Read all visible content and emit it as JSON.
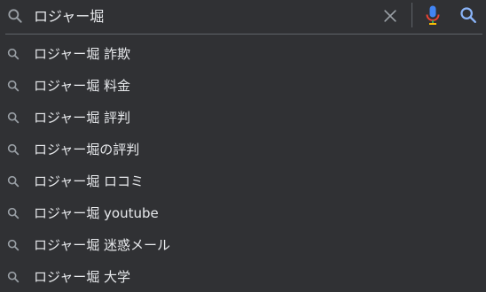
{
  "search": {
    "query": "ロジャー堀",
    "icons": {
      "leading": "search-icon",
      "clear": "close-icon",
      "voice": "microphone-icon",
      "submit": "search-icon"
    },
    "colors": {
      "background": "#303134",
      "text": "#e8eaed",
      "icon": "#9aa0a6",
      "submit": "#8ab4f8",
      "mic_blue": "#4285f4",
      "mic_red": "#ea4335",
      "mic_yellow": "#fbbc05",
      "mic_green": "#34a853"
    }
  },
  "suggestions": [
    {
      "text": "ロジャー堀 詐欺",
      "icon": "search-icon"
    },
    {
      "text": "ロジャー堀 料金",
      "icon": "search-icon"
    },
    {
      "text": "ロジャー堀 評判",
      "icon": "search-icon"
    },
    {
      "text": "ロジャー堀の評判",
      "icon": "search-icon"
    },
    {
      "text": "ロジャー堀 ロコミ",
      "icon": "search-icon"
    },
    {
      "text": "ロジャー堀 youtube",
      "icon": "search-icon"
    },
    {
      "text": "ロジャー堀 迷惑メール",
      "icon": "search-icon"
    },
    {
      "text": "ロジャー堀 大学",
      "icon": "search-icon"
    }
  ]
}
